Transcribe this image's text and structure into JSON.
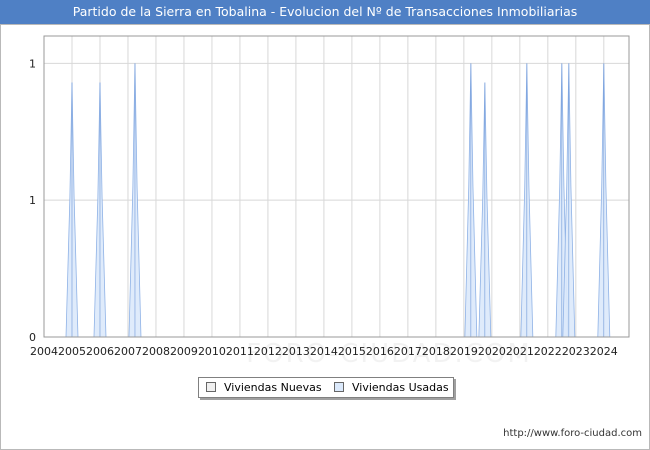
{
  "chart_data": {
    "type": "area",
    "title": "Partido de la Sierra en Tobalina - Evolucion del Nº de Transacciones Inmobiliarias",
    "xlabel": "",
    "ylabel": "",
    "x_ticks": [
      "2004",
      "2005",
      "2006",
      "2007",
      "2008",
      "2009",
      "2010",
      "2011",
      "2012",
      "2013",
      "2014",
      "2015",
      "2016",
      "2017",
      "2018",
      "2019",
      "2020",
      "2021",
      "2022",
      "2023",
      "2024"
    ],
    "y_ticks": [
      "0",
      "1",
      "1"
    ],
    "xlim": [
      2004,
      2024.9
    ],
    "ylim": [
      0,
      1.1
    ],
    "grid": true,
    "legend_position": "bottom",
    "series": [
      {
        "name": "Viviendas Nuevas",
        "color": "#f0f0f0",
        "points": []
      },
      {
        "name": "Viviendas Usadas",
        "color": "#dbe9fb",
        "points": [
          {
            "x": 2005.0,
            "y": 0.93
          },
          {
            "x": 2006.0,
            "y": 0.93
          },
          {
            "x": 2007.25,
            "y": 1.0
          },
          {
            "x": 2019.25,
            "y": 1.0
          },
          {
            "x": 2019.75,
            "y": 0.93
          },
          {
            "x": 2021.25,
            "y": 1.0
          },
          {
            "x": 2022.5,
            "y": 1.0
          },
          {
            "x": 2022.75,
            "y": 1.0
          },
          {
            "x": 2024.0,
            "y": 1.0
          }
        ]
      }
    ]
  },
  "source_text": "http://www.foro-ciudad.com",
  "watermark_text": "FORO-CIUDAD.COM"
}
